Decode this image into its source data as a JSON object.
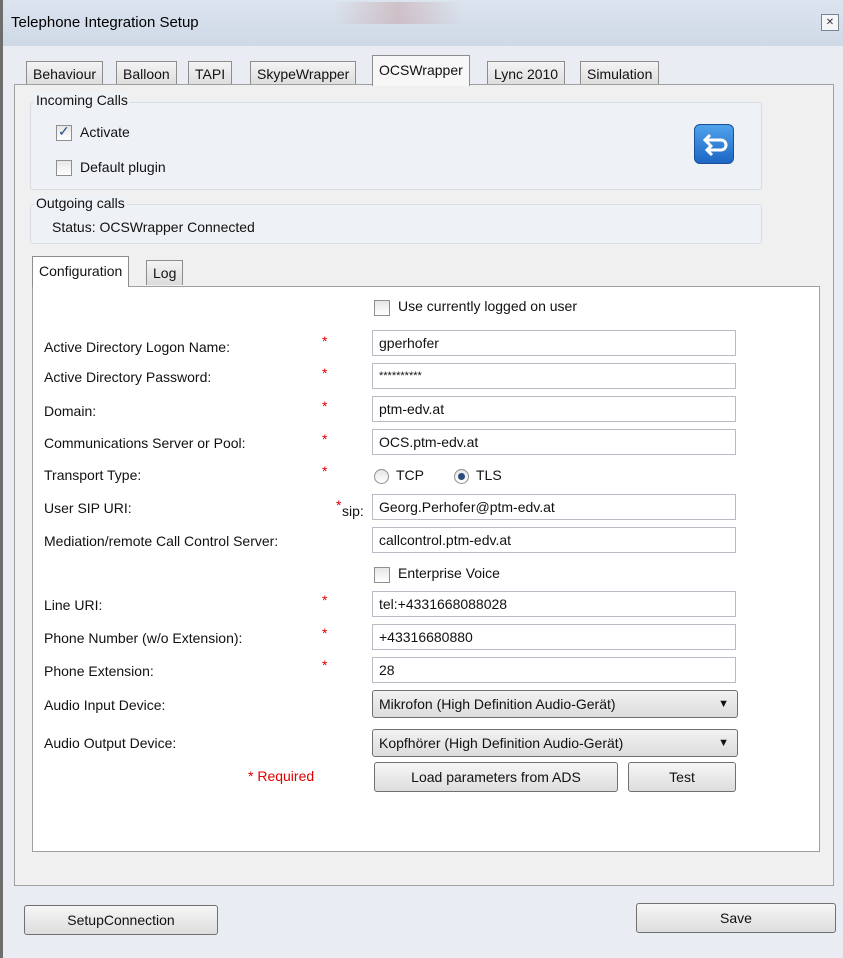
{
  "window": {
    "title": "Telephone Integration Setup",
    "close_label": "✕"
  },
  "tabs": [
    {
      "label": "Behaviour"
    },
    {
      "label": "Balloon"
    },
    {
      "label": "TAPI"
    },
    {
      "label": "SkypeWrapper"
    },
    {
      "label": "OCSWrapper",
      "active": true
    },
    {
      "label": "Lync 2010"
    },
    {
      "label": "Simulation"
    }
  ],
  "incoming": {
    "title": "Incoming Calls",
    "activate_label": "Activate",
    "activate_checked": true,
    "default_plugin_label": "Default plugin",
    "default_plugin_checked": false
  },
  "outgoing": {
    "title": "Outgoing calls",
    "status": "Status: OCSWrapper Connected"
  },
  "subtabs": [
    {
      "label": "Configuration",
      "active": true
    },
    {
      "label": "Log"
    }
  ],
  "config": {
    "use_current_user_label": "Use currently logged on user",
    "logon_name": {
      "label": "Active Directory Logon Name:",
      "value": "gperhofer"
    },
    "password": {
      "label": "Active Directory Password:",
      "value": "**********"
    },
    "domain": {
      "label": "Domain:",
      "value": "ptm-edv.at"
    },
    "server": {
      "label": "Communications Server or Pool:",
      "value": "OCS.ptm-edv.at"
    },
    "transport": {
      "label": "Transport Type:",
      "opt_tcp": "TCP",
      "opt_tls": "TLS",
      "selected": "TLS"
    },
    "sip": {
      "label": "User SIP URI:",
      "prefix": "sip:",
      "value": "Georg.Perhofer@ptm-edv.at"
    },
    "mediation": {
      "label": "Mediation/remote Call Control Server:",
      "value": "callcontrol.ptm-edv.at"
    },
    "enterprise_voice_label": "Enterprise Voice",
    "line_uri": {
      "label": "Line URI:",
      "value": "tel:+4331668088028"
    },
    "phone": {
      "label": "Phone Number (w/o Extension):",
      "value": "+43316680880"
    },
    "extension": {
      "label": "Phone Extension:",
      "value": "28"
    },
    "audio_in": {
      "label": "Audio Input Device:",
      "value": "Mikrofon (High Definition Audio-Gerät)"
    },
    "audio_out": {
      "label": "Audio Output Device:",
      "value": "Kopfhörer (High Definition Audio-Gerät)"
    },
    "required_note": "* Required",
    "required_mark": "*",
    "load_button": "Load parameters from ADS",
    "test_button": "Test"
  },
  "footer": {
    "setup_button": "SetupConnection",
    "save_button": "Save"
  },
  "icons": {
    "swap": "swap-arrows-icon",
    "dropdown": "chevron-down-icon"
  },
  "colors": {
    "required": "#e00000",
    "icon_blue": "#1d66c5"
  }
}
